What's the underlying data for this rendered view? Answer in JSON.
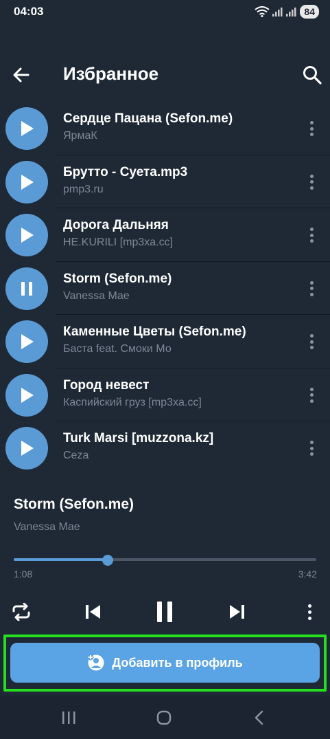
{
  "status_bar": {
    "time": "04:03",
    "battery": "84"
  },
  "header": {
    "title": "Избранное"
  },
  "tracks": [
    {
      "title": "Сердце Пацана (Sefon.me)",
      "artist": "ЯрмаК",
      "state": "play"
    },
    {
      "title": "Брутто - Суета.mp3",
      "artist": "pmp3.ru",
      "state": "play"
    },
    {
      "title": "Дорога Дальняя",
      "artist": "НЕ.KURILI [mp3xa.cc]",
      "state": "play"
    },
    {
      "title": "Storm (Sefon.me)",
      "artist": "Vanessa Mae",
      "state": "pause"
    },
    {
      "title": "Каменные Цветы (Sefon.me)",
      "artist": "Баста feat. Смоки Мо",
      "state": "play"
    },
    {
      "title": "Город невест",
      "artist": "Каспийский груз [mp3xa.cc]",
      "state": "play"
    },
    {
      "title": "Turk Marsi [muzzona.kz]",
      "artist": "Ceza",
      "state": "play"
    }
  ],
  "now_playing": {
    "title": "Storm (Sefon.me)",
    "artist": "Vanessa Mae",
    "current_time": "1:08",
    "total_time": "3:42",
    "progress": 0.31
  },
  "add_button": {
    "label": "Добавить в профиль"
  },
  "colors": {
    "accent": "#5b9bd5",
    "background": "#1f2936",
    "highlight": "#26e01f"
  }
}
